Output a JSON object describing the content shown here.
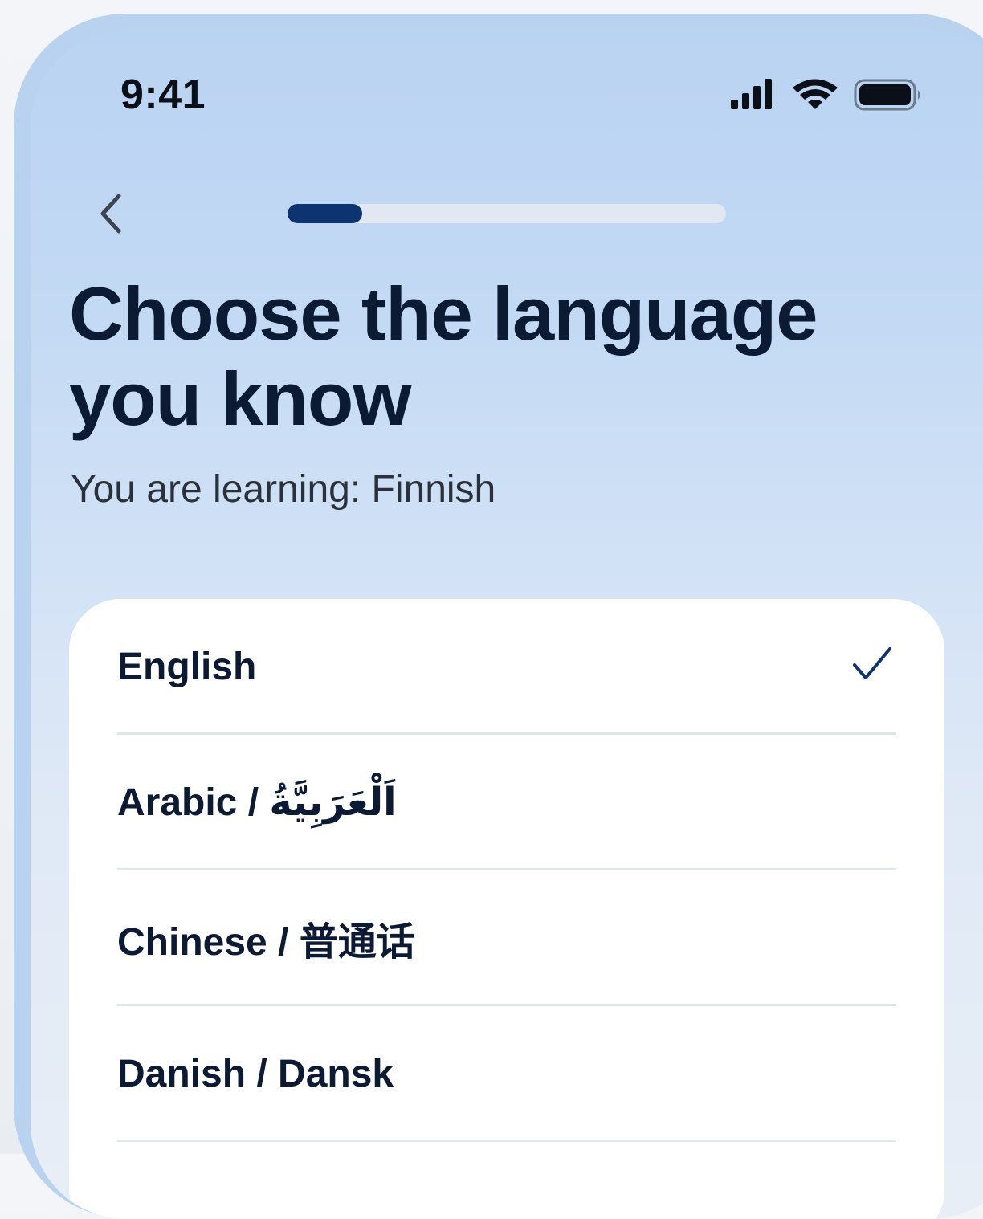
{
  "status_bar": {
    "time": "9:41",
    "icons": [
      "cellular-signal-icon",
      "wifi-icon",
      "battery-icon"
    ]
  },
  "header": {
    "back_icon": "chevron-left-icon",
    "progress": 0.17
  },
  "title": "Choose the language you know",
  "subtitle": "You are learning: Finnish",
  "languages": [
    {
      "label": "English",
      "selected": true
    },
    {
      "label": "Arabic / اَلْعَرَبِيَّةُ",
      "selected": false
    },
    {
      "label": "Chinese / 普通话",
      "selected": false
    },
    {
      "label": "Danish / Dansk",
      "selected": false
    }
  ],
  "colors": {
    "accent": "#0d3470",
    "title": "#0b1b33",
    "check": "#0d3470",
    "progress_track": "#e2e8f1"
  }
}
